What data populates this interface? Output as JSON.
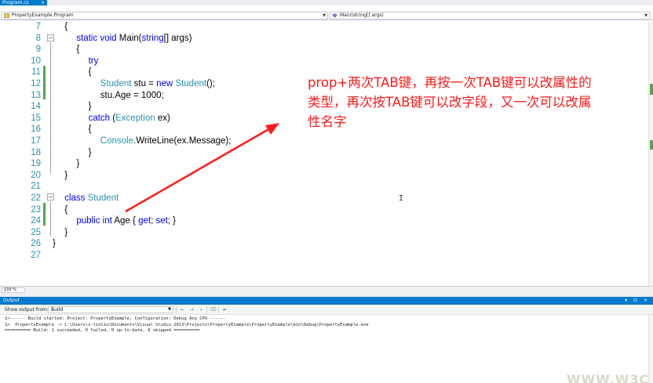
{
  "tab": {
    "label": "Program.cs",
    "close": "×"
  },
  "nav": {
    "left_value": "PropertyExample.Program",
    "right_value": "Main(string[] args)"
  },
  "code_lines": [
    {
      "num": "7",
      "indent": 1,
      "parts": [
        [
          "t",
          "{"
        ]
      ]
    },
    {
      "num": "8",
      "indent": 2,
      "parts": [
        [
          "kw",
          "static "
        ],
        [
          "kw",
          "void "
        ],
        [
          "t",
          "Main("
        ],
        [
          "kw",
          "string"
        ],
        [
          "t",
          "[] args)"
        ]
      ]
    },
    {
      "num": "9",
      "indent": 2,
      "parts": [
        [
          "t",
          "{"
        ]
      ]
    },
    {
      "num": "10",
      "indent": 3,
      "parts": [
        [
          "kw",
          "try"
        ]
      ]
    },
    {
      "num": "11",
      "indent": 3,
      "parts": [
        [
          "t",
          "{"
        ]
      ]
    },
    {
      "num": "12",
      "indent": 4,
      "parts": [
        [
          "ty",
          "Student"
        ],
        [
          "t",
          " stu = "
        ],
        [
          "kw",
          "new "
        ],
        [
          "ty",
          "Student"
        ],
        [
          "t",
          "();"
        ]
      ]
    },
    {
      "num": "13",
      "indent": 4,
      "parts": [
        [
          "t",
          "stu.Age = 1000;"
        ]
      ]
    },
    {
      "num": "14",
      "indent": 3,
      "parts": [
        [
          "t",
          "}"
        ]
      ]
    },
    {
      "num": "15",
      "indent": 3,
      "parts": [
        [
          "kw",
          "catch"
        ],
        [
          "t",
          " ("
        ],
        [
          "ty",
          "Exception"
        ],
        [
          "t",
          " ex)"
        ]
      ]
    },
    {
      "num": "16",
      "indent": 3,
      "parts": [
        [
          "t",
          "{"
        ]
      ]
    },
    {
      "num": "17",
      "indent": 4,
      "parts": [
        [
          "ty",
          "Console"
        ],
        [
          "t",
          ".WriteLine(ex.Message);"
        ]
      ]
    },
    {
      "num": "18",
      "indent": 3,
      "parts": [
        [
          "t",
          "}"
        ]
      ]
    },
    {
      "num": "19",
      "indent": 2,
      "parts": [
        [
          "t",
          "}"
        ]
      ]
    },
    {
      "num": "20",
      "indent": 1,
      "parts": [
        [
          "t",
          "}"
        ]
      ]
    },
    {
      "num": "21",
      "indent": 0,
      "parts": []
    },
    {
      "num": "22",
      "indent": 1,
      "parts": [
        [
          "kw",
          "class "
        ],
        [
          "ty",
          "Student"
        ]
      ]
    },
    {
      "num": "23",
      "indent": 1,
      "parts": [
        [
          "t",
          "{"
        ]
      ]
    },
    {
      "num": "24",
      "indent": 2,
      "parts": [
        [
          "kw",
          "public "
        ],
        [
          "kw",
          "int "
        ],
        [
          "t",
          "Age { "
        ],
        [
          "kw",
          "get"
        ],
        [
          "t",
          "; "
        ],
        [
          "kw",
          "set"
        ],
        [
          "t",
          "; }"
        ]
      ]
    },
    {
      "num": "25",
      "indent": 1,
      "parts": [
        [
          "t",
          "}"
        ]
      ]
    },
    {
      "num": "26",
      "indent": 0,
      "parts": [
        [
          "t",
          "}"
        ]
      ]
    },
    {
      "num": "27",
      "indent": 0,
      "parts": []
    }
  ],
  "annotation": {
    "line1": "prop+两次TAB键，再按一次TAB键可以改属性的",
    "line2": "类型，再次按TAB键可以改字段，又一次可以改属",
    "line3": "性名字"
  },
  "zoom": {
    "value": "133 %"
  },
  "output": {
    "title": "Output",
    "header_buttons": "▾ ⊡ ×",
    "show_from_label": "Show output from:",
    "show_from_value": "Build",
    "lines": [
      "1>------ Build started: Project: PropertyExample, Configuration: Debug Any CPU ------",
      "1>  PropertyExample -> C:\\Users\\v-tinliu\\Documents\\Visual Studio 2013\\Projects\\PropertyExample\\PropertyExample\\bin\\Debug\\PropertyExample.exe",
      "========== Build: 1 succeeded, 0 failed, 0 up-to-date, 0 skipped =========="
    ]
  },
  "watermark": {
    "text": "WWW.W3C"
  },
  "colors": {
    "accent": "#007acc",
    "keyword": "#0000ff",
    "type": "#2b91af",
    "annotation": "#ff1a1a",
    "change": "#57a64a"
  }
}
